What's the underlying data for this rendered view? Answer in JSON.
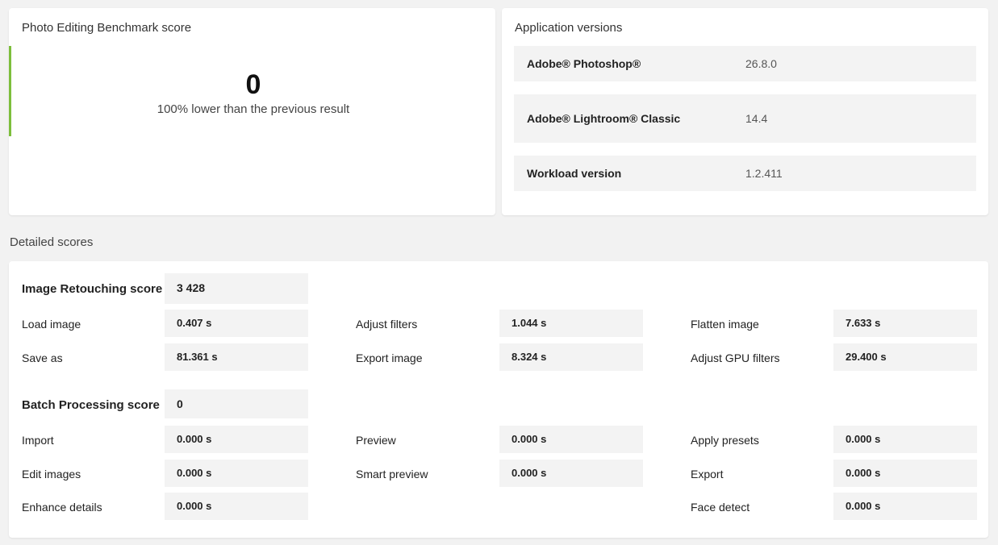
{
  "score_card": {
    "title": "Photo Editing Benchmark score",
    "score": "0",
    "comparison": "100% lower than the previous result",
    "accent_color": "#7dbe3c"
  },
  "versions": {
    "title": "Application versions",
    "rows": [
      {
        "name": "Adobe® Photoshop®",
        "value": "26.8.0"
      },
      {
        "name": "Adobe® Lightroom® Classic",
        "value": "14.4"
      },
      {
        "name": "Workload version",
        "value": "1.2.411"
      }
    ]
  },
  "details": {
    "title": "Detailed scores",
    "retouching": {
      "label": "Image Retouching score",
      "score": "3 428",
      "items": [
        {
          "label": "Load image",
          "value": "0.407 s"
        },
        {
          "label": "Adjust filters",
          "value": "1.044 s"
        },
        {
          "label": "Flatten image",
          "value": "7.633 s"
        },
        {
          "label": "Save as",
          "value": "81.361 s"
        },
        {
          "label": "Export image",
          "value": "8.324 s"
        },
        {
          "label": "Adjust GPU filters",
          "value": "29.400 s"
        }
      ]
    },
    "batch": {
      "label": "Batch Processing score",
      "score": "0",
      "items": [
        {
          "label": "Import",
          "value": "0.000 s"
        },
        {
          "label": "Preview",
          "value": "0.000 s"
        },
        {
          "label": "Apply presets",
          "value": "0.000 s"
        },
        {
          "label": "Edit images",
          "value": "0.000 s"
        },
        {
          "label": "Smart preview",
          "value": "0.000 s"
        },
        {
          "label": "Export",
          "value": "0.000 s"
        },
        {
          "label": "Enhance details",
          "value": "0.000 s"
        },
        {
          "label": "Face detect",
          "value": "0.000 s"
        }
      ]
    }
  }
}
